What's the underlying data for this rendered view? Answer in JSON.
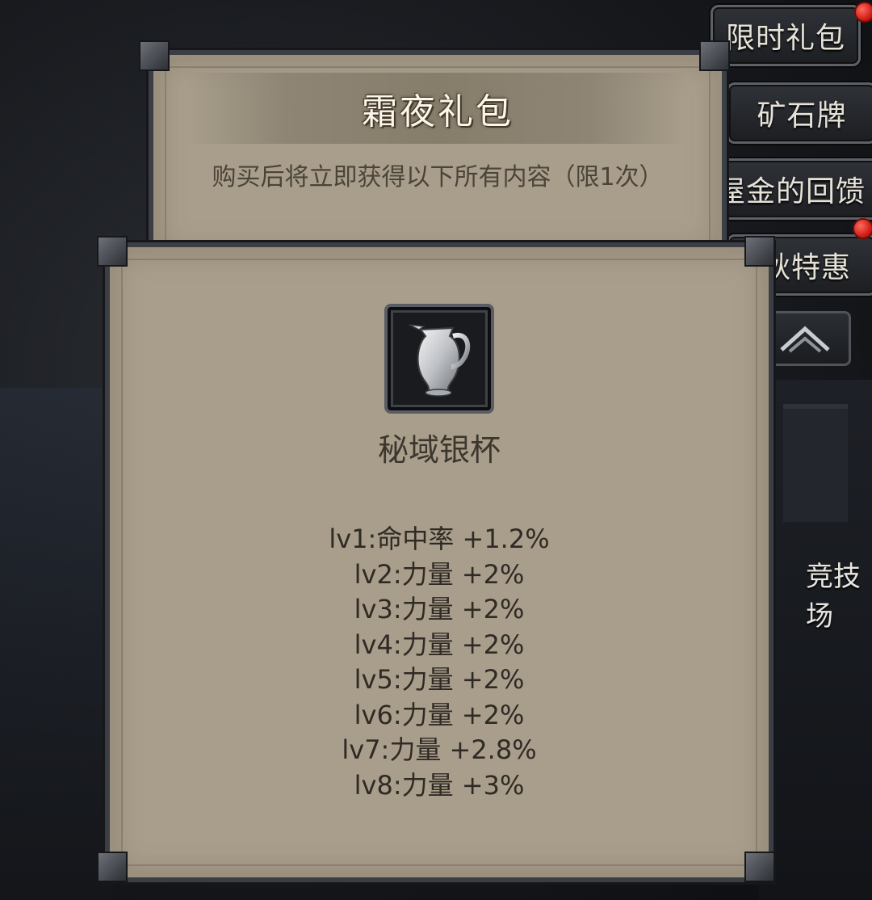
{
  "popup": {
    "title": "霜夜礼包",
    "description": "购买后将立即获得以下所有内容（限1次）"
  },
  "item": {
    "icon": "silver-cup-icon",
    "name": "秘域银杯",
    "stats": [
      "lv1:命中率 +1.2%",
      "lv2:力量 +2%",
      "lv3:力量 +2%",
      "lv4:力量 +2%",
      "lv5:力量 +2%",
      "lv6:力量 +2%",
      "lv7:力量 +2.8%",
      "lv8:力量 +3%"
    ]
  },
  "side_menu": {
    "limited_pack": "限时礼包",
    "ore_card": "矿石牌",
    "gold_reward": "屋金的回馈",
    "special_offer": "秋特惠",
    "arena": "竞技场"
  },
  "colors": {
    "panel": "#a99e8c",
    "frame": "#3b3e44",
    "notification": "#d0170f"
  }
}
